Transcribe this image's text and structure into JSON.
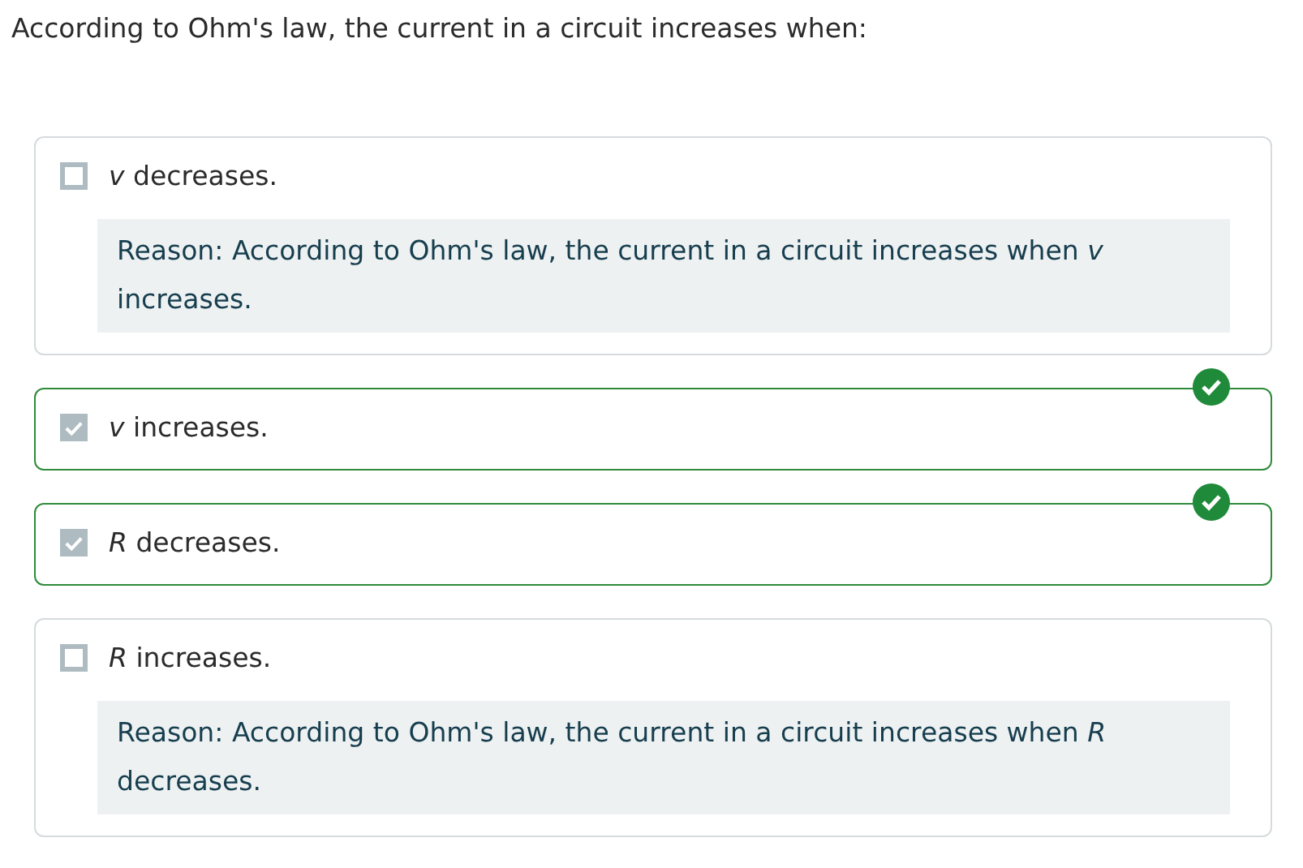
{
  "question": "According to Ohm's law, the current in a circuit increases when:",
  "options": [
    {
      "text": "*v* decreases.",
      "checked": false,
      "correct": false,
      "reason": "Reason: According to Ohm's law, the current in a circuit increases when *v* increases."
    },
    {
      "text": "*v* increases.",
      "checked": true,
      "correct": true
    },
    {
      "text": "*R* decreases.",
      "checked": true,
      "correct": true
    },
    {
      "text": "*R* increases.",
      "checked": false,
      "correct": false,
      "reason": "Reason: According to Ohm's law, the current in a circuit increases when *R* decreases."
    }
  ]
}
